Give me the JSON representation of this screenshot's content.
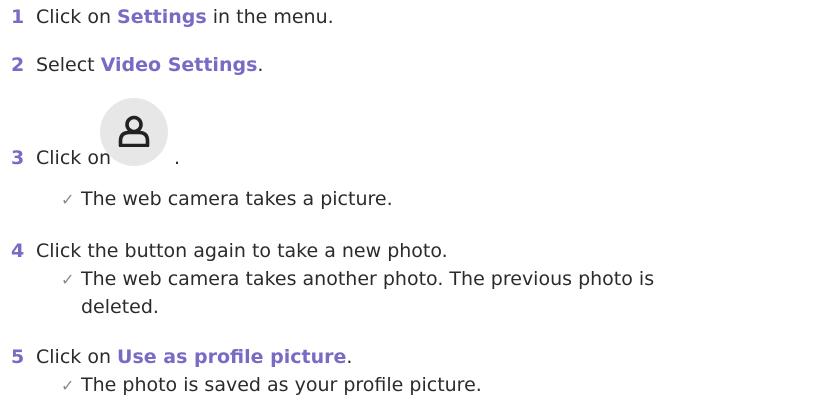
{
  "steps": [
    {
      "number": "1",
      "parts": [
        "Click on ",
        "Settings",
        " in the menu."
      ]
    },
    {
      "number": "2",
      "parts": [
        "Select ",
        "Video Settings",
        "."
      ]
    },
    {
      "number": "3",
      "before": "Click on",
      "after": ".",
      "button_icon": "user-profile-icon",
      "result": "The web camera takes a picture."
    },
    {
      "number": "4",
      "text": "Click the button again to take a new photo.",
      "result_line1": "The web camera takes another photo. The previous photo is",
      "result_line2": "deleted."
    },
    {
      "number": "5",
      "parts": [
        "Click on ",
        "Use as profile picture",
        "."
      ],
      "result": "The photo is saved as your profile picture."
    }
  ],
  "result_icon": "checkmark-icon",
  "colors": {
    "accent": "#7a6ac4",
    "text": "#2b2b2b",
    "button_bg": "#e7e7e7"
  }
}
